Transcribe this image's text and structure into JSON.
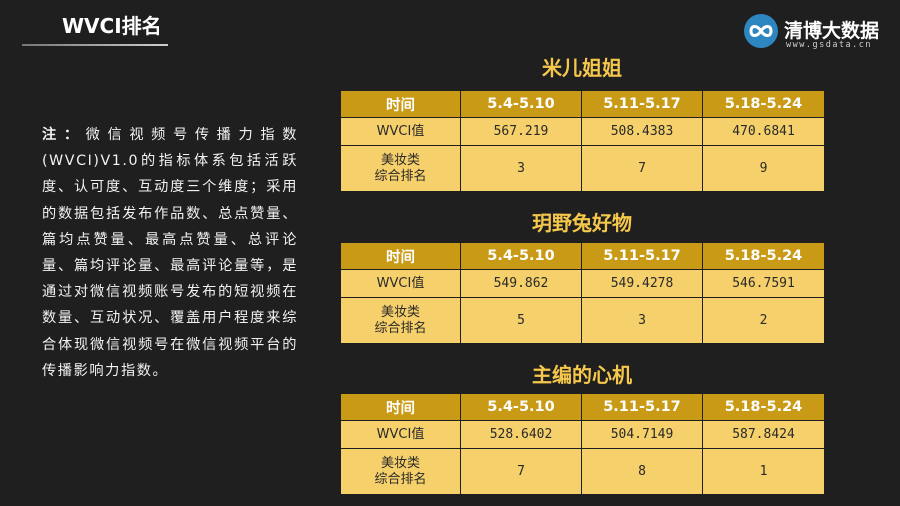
{
  "header": {
    "title": "WVCI排名"
  },
  "logo": {
    "name": "清博大数据",
    "url": "www.gsdata.cn",
    "icon": "infinity-icon",
    "color": "#2e86c1"
  },
  "note": {
    "label": "注：",
    "text": "微信视频号传播力指数(WVCI)V1.0的指标体系包括活跃度、认可度、互动度三个维度；采用的数据包括发布作品数、总点赞量、篇均点赞量、最高点赞量、总评论量、篇均评论量、最高评论量等，是通过对微信视频账号发布的短视频在数量、互动状况、覆盖用户程度来综合体现微信视频号在微信视频平台的传播影响力指数。"
  },
  "colors": {
    "accent": "#f5c84c",
    "header_cell": "#c99a16",
    "body_cell": "#f6d06a"
  },
  "tables": [
    {
      "title": "米儿姐姐",
      "header": [
        "时间",
        "5.4-5.10",
        "5.11-5.17",
        "5.18-5.24"
      ],
      "rows": [
        [
          "WVCI值",
          "567.219",
          "508.4383",
          "470.6841"
        ],
        [
          "美妆类\n综合排名",
          "3",
          "7",
          "9"
        ]
      ]
    },
    {
      "title": "玥野兔好物",
      "header": [
        "时间",
        "5.4-5.10",
        "5.11-5.17",
        "5.18-5.24"
      ],
      "rows": [
        [
          "WVCI值",
          "549.862",
          "549.4278",
          "546.7591"
        ],
        [
          "美妆类\n综合排名",
          "5",
          "3",
          "2"
        ]
      ]
    },
    {
      "title": "主编的心机",
      "header": [
        "时间",
        "5.4-5.10",
        "5.11-5.17",
        "5.18-5.24"
      ],
      "rows": [
        [
          "WVCI值",
          "528.6402",
          "504.7149",
          "587.8424"
        ],
        [
          "美妆类\n综合排名",
          "7",
          "8",
          "1"
        ]
      ]
    }
  ]
}
